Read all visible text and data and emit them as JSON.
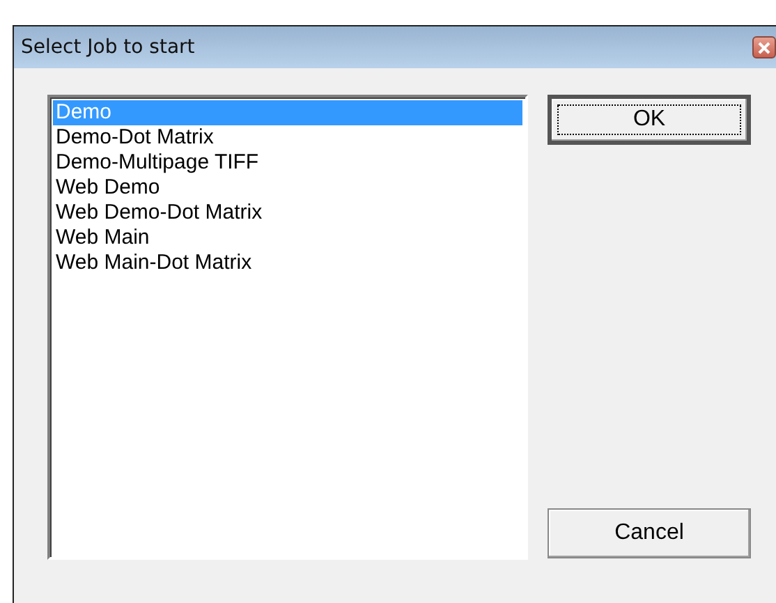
{
  "window": {
    "title": "Select Job to start"
  },
  "jobs": [
    {
      "label": "Demo",
      "selected": true
    },
    {
      "label": "Demo-Dot Matrix",
      "selected": false
    },
    {
      "label": "Demo-Multipage TIFF",
      "selected": false
    },
    {
      "label": "Web Demo",
      "selected": false
    },
    {
      "label": "Web Demo-Dot Matrix",
      "selected": false
    },
    {
      "label": "Web Main",
      "selected": false
    },
    {
      "label": "Web Main-Dot Matrix",
      "selected": false
    }
  ],
  "buttons": [
    {
      "label": "OK",
      "kind": "default"
    },
    {
      "label": "Cancel",
      "kind": "normal"
    }
  ]
}
